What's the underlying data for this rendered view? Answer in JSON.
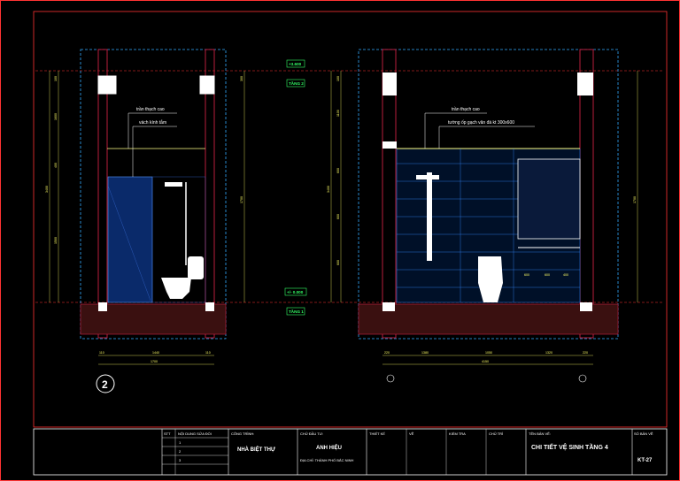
{
  "left_view": {
    "ceiling_label": "trần thạch cao",
    "partition_label": "vách kính tắm",
    "overall_height": "3400",
    "heights": [
      "100",
      "1600",
      "400",
      "1500",
      "300",
      "1700"
    ],
    "widths": [
      "110",
      "1440",
      "110"
    ],
    "total_width": "1700",
    "view_number": "2"
  },
  "right_view": {
    "ceiling_label": "trần thạch cao",
    "tile_label": "tường ốp gạch vân đá kt 300x600",
    "overall_height": "3400",
    "heights": [
      "100",
      "1100",
      "600",
      "600",
      "600",
      "1700"
    ],
    "widths": [
      "220",
      "1380",
      "1050",
      "1320",
      "220"
    ],
    "total_width": "4150",
    "fixture_dims": [
      "600",
      "600",
      "400"
    ]
  },
  "levels": {
    "upper_value": "+3.600",
    "upper_name": "TẦNG 2",
    "lower_value": "+/- 0.000",
    "lower_name": "TẦNG 1"
  },
  "title_block": {
    "project_label": "CÔNG TRÌNH:",
    "project": "NHÀ BIỆT THỰ",
    "owner_label": "CHỦ ĐẦU TƯ:",
    "owner": "ANH HIỆU",
    "owner_addr": "ĐỊA CHỈ: THÀNH PHỐ BẮC NINH",
    "roles": [
      "THIẾT KẾ",
      "VẼ",
      "KIỂM TRA",
      "CHỦ TRÌ"
    ],
    "drawing_label": "TÊN BẢN VẼ:",
    "drawing_title": "CHI TIẾT VỆ SINH TẦNG 4",
    "sheet_label": "SỐ BẢN VẼ",
    "sheet_no": "KT-27",
    "revision_header": [
      "STT",
      "NỘI DUNG SỬA ĐỔI"
    ],
    "revision_rows": [
      "1",
      "2",
      "3"
    ]
  },
  "colors": {
    "background": "#000000",
    "frame": "#ff3333",
    "grid": "#33aaff",
    "wall": "#cc2244",
    "level_text": "#33ff66",
    "dimension_text": "#ffff66",
    "tile_lines": "#3388ff"
  }
}
